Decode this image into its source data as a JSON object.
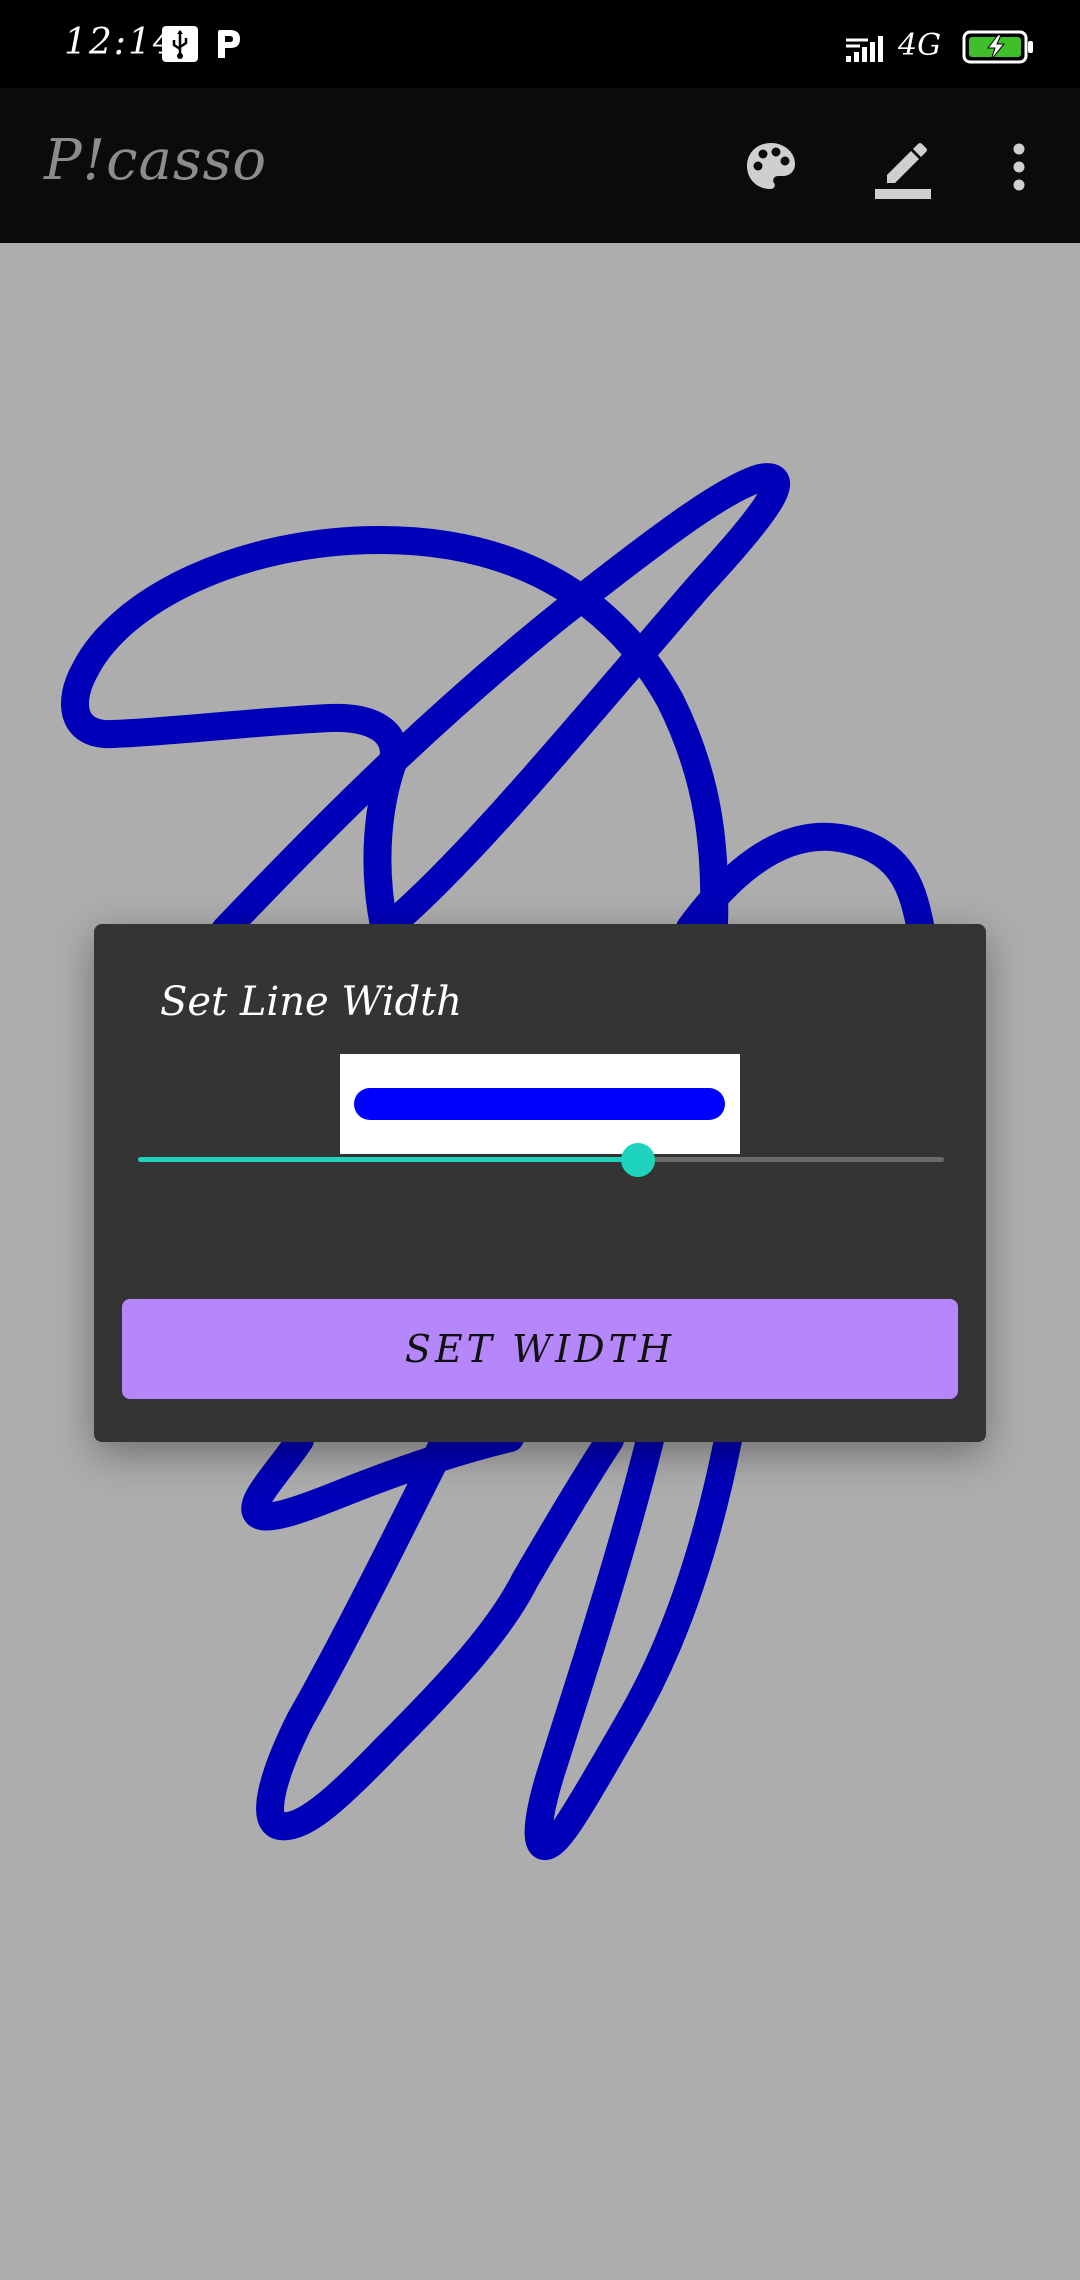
{
  "status_bar": {
    "time": "12:14",
    "network": "4G",
    "icons": [
      "usb-icon",
      "p-notification-icon",
      "signal-icon",
      "battery-charging-icon"
    ]
  },
  "app_bar": {
    "title": "P!casso",
    "actions": [
      "palette-icon",
      "pen-width-icon",
      "more-vert-icon"
    ]
  },
  "canvas": {
    "stroke_color": "#0000b8",
    "background_color": "#adadad"
  },
  "dialog": {
    "title": "Set Line Width",
    "preview_line_color": "#0000ff",
    "slider_value_fraction": 0.62,
    "slider_color": "#1ed3bd",
    "button_label": "SET WIDTH",
    "button_color": "#b587fb"
  }
}
